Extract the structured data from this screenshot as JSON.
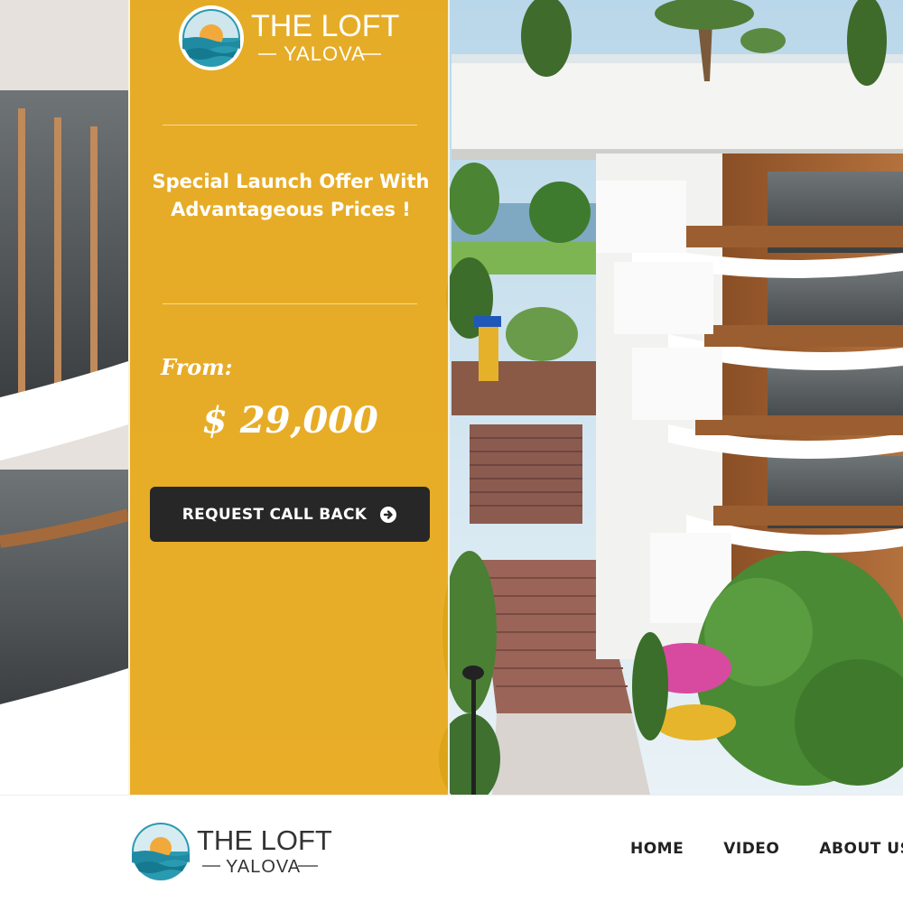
{
  "brand": {
    "name_line1": "THE LOFT",
    "name_line2": "YALOVA"
  },
  "hero": {
    "offer_text": "Special Launch Offer With Advantageous Prices !",
    "from_label": "From:",
    "price": "$ 29,000",
    "cta_label": "REQUEST CALL BACK",
    "cta_icon": "circle-arrow-right-icon"
  },
  "nav": {
    "items": [
      {
        "label": "HOME"
      },
      {
        "label": "VIDEO"
      },
      {
        "label": "ABOUT US"
      }
    ]
  },
  "colors": {
    "panel": "#e8a818",
    "cta_bg": "#272727",
    "nav_text": "#222222",
    "logo_teal": "#2a9ab0",
    "logo_sun": "#f2a93b"
  }
}
